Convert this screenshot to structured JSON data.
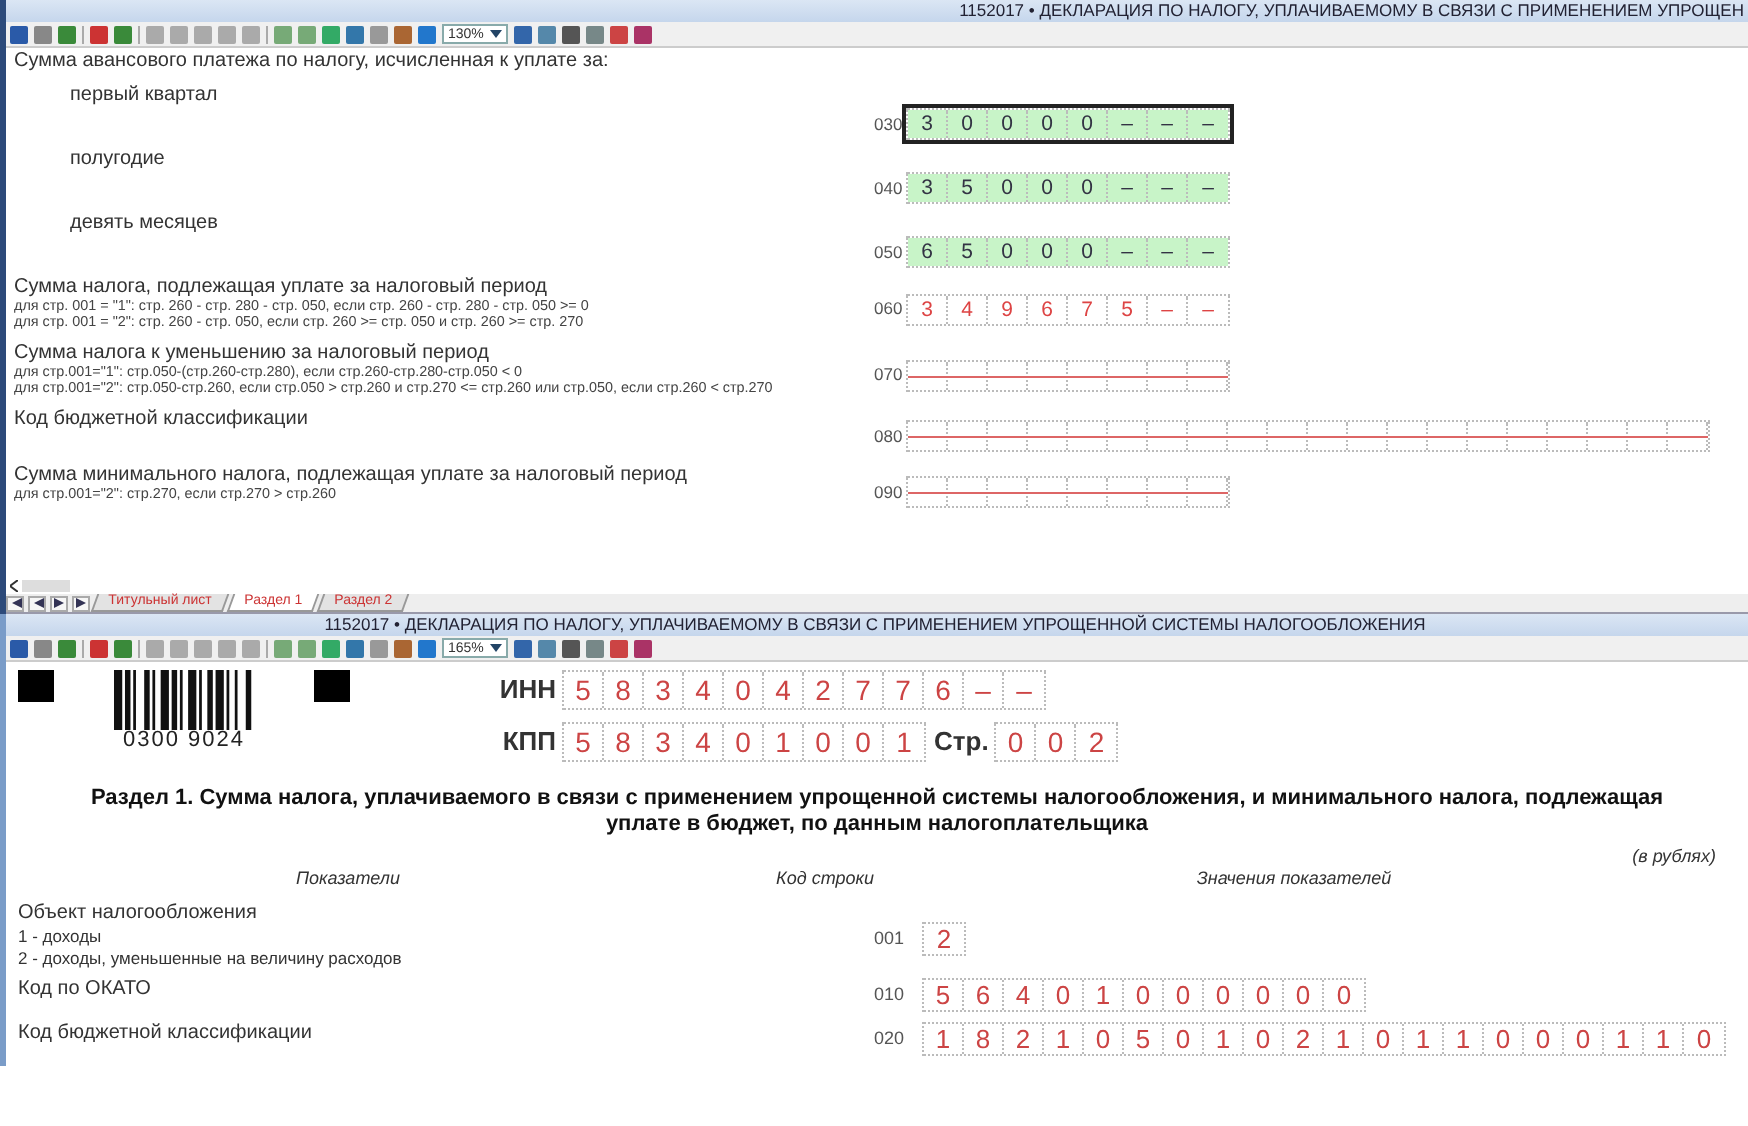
{
  "top_window": {
    "title": "1152017 • ДЕКЛАРАЦИЯ ПО НАЛОГУ, УПЛАЧИВАЕМОМУ В СВЯЗИ С ПРИМЕНЕНИЕМ УПРОЩЕН",
    "zoom": "130%",
    "rows": [
      {
        "label": "Сумма авансового платежа по налогу, исчисленная к уплате за:",
        "children": [
          {
            "label": "первый квартал",
            "code": "030",
            "kind": "entered",
            "selected": true,
            "cells": [
              "3",
              "0",
              "0",
              "0",
              "0",
              "–",
              "–",
              "–"
            ]
          },
          {
            "label": "полугодие",
            "code": "040",
            "kind": "entered",
            "selected": false,
            "cells": [
              "3",
              "5",
              "0",
              "0",
              "0",
              "–",
              "–",
              "–"
            ]
          },
          {
            "label": "девять месяцев",
            "code": "050",
            "kind": "entered",
            "selected": false,
            "cells": [
              "6",
              "5",
              "0",
              "0",
              "0",
              "–",
              "–",
              "–"
            ]
          }
        ]
      },
      {
        "label": "Сумма налога, подлежащая уплате за налоговый период",
        "notes": [
          "для стр. 001 = \"1\": стр. 260 - стр. 280 - стр. 050, если стр. 260 - стр. 280 - стр. 050 >= 0",
          "для стр. 001 = \"2\": стр. 260 - стр. 050, если стр. 260 >= стр. 050 и стр. 260 >= стр. 270"
        ],
        "code": "060",
        "kind": "computed",
        "selected": false,
        "cells": [
          "3",
          "4",
          "9",
          "6",
          "7",
          "5",
          "–",
          "–"
        ]
      },
      {
        "label": "Сумма налога к уменьшению за налоговый период",
        "notes": [
          "для стр.001=\"1\": стр.050-(стр.260-стр.280), если стр.260-стр.280-стр.050 < 0",
          "для стр.001=\"2\": стр.050-стр.260, если стр.050 > стр.260 и стр.270 <= стр.260 или стр.050, если стр.260 < стр.270"
        ],
        "code": "070",
        "kind": "blank",
        "selected": false
      },
      {
        "label": "Код бюджетной классификации",
        "code": "080",
        "kind": "blank_wide",
        "selected": false
      },
      {
        "label": "Сумма минимального налога, подлежащая уплате за налоговый период",
        "notes": [
          "для стр.001=\"2\": стр.270, если стр.270 > стр.260"
        ],
        "code": "090",
        "kind": "blank",
        "selected": false
      }
    ],
    "tabs": [
      {
        "label": "Титульный лист",
        "selected": false
      },
      {
        "label": "Раздел 1",
        "selected": true
      },
      {
        "label": "Раздел 2",
        "selected": false
      }
    ]
  },
  "bottom_window": {
    "title": "1152017 • ДЕКЛАРАЦИЯ ПО НАЛОГУ, УПЛАЧИВАЕМОМУ В СВЯЗИ С ПРИМЕНЕНИЕМ УПРОЩЕННОЙ СИСТЕМЫ НАЛОГООБЛОЖЕНИЯ",
    "zoom": "165%",
    "barcode_number": "0300 9024",
    "inn": {
      "label": "ИНН",
      "cells": [
        "5",
        "8",
        "3",
        "4",
        "0",
        "4",
        "2",
        "7",
        "7",
        "6",
        "–",
        "–"
      ]
    },
    "kpp": {
      "label": "КПП",
      "cells": [
        "5",
        "8",
        "3",
        "4",
        "0",
        "1",
        "0",
        "0",
        "1"
      ]
    },
    "page": {
      "label": "Стр.",
      "cells": [
        "0",
        "0",
        "2"
      ]
    },
    "section_title": "Раздел 1. Сумма налога, уплачиваемого в связи с применением упрощенной системы налогообложения, и минимального налога, подлежащая уплате в бюджет, по данным налогоплательщика",
    "units": "(в рублях)",
    "captions": [
      "Показатели",
      "Код строки",
      "Значения показателей"
    ],
    "rows": [
      {
        "label": "Объект налогообложения",
        "notes": [
          "1 - доходы",
          "2 - доходы, уменьшенные на величину расходов"
        ],
        "code": "001",
        "cells": [
          "2"
        ]
      },
      {
        "label": "Код по ОКАТО",
        "code": "010",
        "cells": [
          "5",
          "6",
          "4",
          "0",
          "1",
          "0",
          "0",
          "0",
          "0",
          "0",
          "0"
        ]
      },
      {
        "label": "Код бюджетной классификации",
        "code": "020",
        "cells": [
          "1",
          "8",
          "2",
          "1",
          "0",
          "5",
          "0",
          "1",
          "0",
          "2",
          "1",
          "0",
          "1",
          "1",
          "0",
          "0",
          "0",
          "1",
          "1",
          "0"
        ]
      }
    ]
  }
}
